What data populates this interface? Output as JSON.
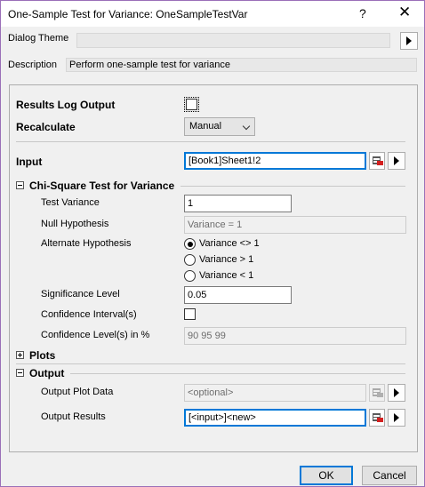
{
  "window": {
    "title": "One-Sample Test for Variance: OneSampleTestVar",
    "help_label": "?",
    "close_label": "✕"
  },
  "theme": {
    "label": "Dialog Theme",
    "value": ""
  },
  "description": {
    "label": "Description",
    "value": "Perform one-sample test for variance"
  },
  "results_log": {
    "label": "Results Log Output",
    "checked": false
  },
  "recalculate": {
    "label": "Recalculate",
    "value": "Manual"
  },
  "input": {
    "label": "Input",
    "value": "[Book1]Sheet1!2"
  },
  "chi_square": {
    "header": "Chi-Square Test for Variance",
    "test_variance_label": "Test Variance",
    "test_variance_value": "1",
    "null_hypothesis_label": "Null Hypothesis",
    "null_hypothesis_value": "Variance = 1",
    "alternate_label": "Alternate Hypothesis",
    "alternate_options": [
      "Variance <> 1",
      "Variance > 1",
      "Variance < 1"
    ],
    "alternate_selected": 0,
    "significance_label": "Significance Level",
    "significance_value": "0.05",
    "ci_label": "Confidence Interval(s)",
    "ci_checked": false,
    "cl_label": "Confidence Level(s) in %",
    "cl_value": "90 95 99"
  },
  "plots": {
    "header": "Plots"
  },
  "output": {
    "header": "Output",
    "plot_data_label": "Output Plot Data",
    "plot_data_value": "<optional>",
    "results_label": "Output Results",
    "results_value": "[<input>]<new>"
  },
  "buttons": {
    "ok": "OK",
    "cancel": "Cancel"
  }
}
